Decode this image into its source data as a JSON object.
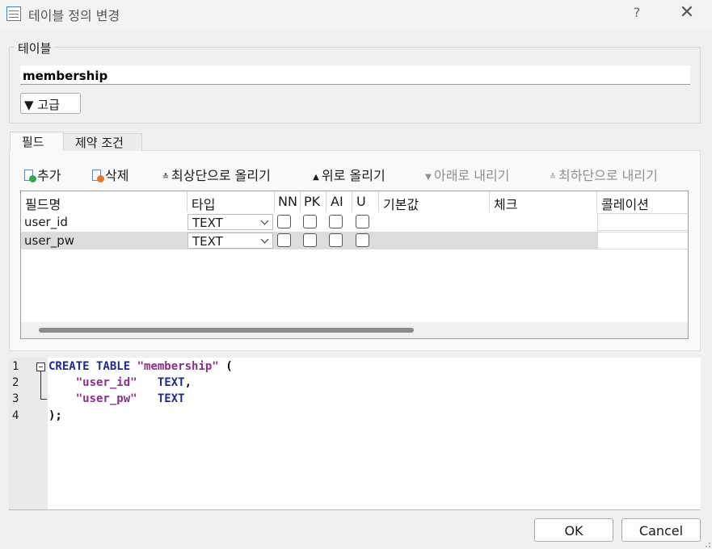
{
  "window": {
    "title": "테이블 정의 변경",
    "help": "?",
    "close": "✕"
  },
  "table_group": {
    "legend": "테이블",
    "name_value": "membership",
    "advanced_label": "▼ 고급"
  },
  "tabs": [
    {
      "label": "필드",
      "active": true
    },
    {
      "label": "제약 조건",
      "active": false
    }
  ],
  "toolbar": {
    "add": "추가",
    "delete": "삭제",
    "move_top": "최상단으로 올리기",
    "move_up": "위로 올리기",
    "move_down": "아래로 내리기",
    "move_bottom": "최하단으로 내리기"
  },
  "grid": {
    "columns": [
      "필드명",
      "타입",
      "NN",
      "PK",
      "AI",
      "U",
      "기본값",
      "체크",
      "콜레이션"
    ],
    "rows": [
      {
        "name": "user_id",
        "type": "TEXT",
        "nn": false,
        "pk": false,
        "ai": false,
        "u": false,
        "default": "",
        "check": "",
        "collation": ""
      },
      {
        "name": "user_pw",
        "type": "TEXT",
        "nn": false,
        "pk": false,
        "ai": false,
        "u": false,
        "default": "",
        "check": "",
        "collation": ""
      }
    ]
  },
  "sql": {
    "line_numbers": [
      "1",
      "2",
      "3",
      "4"
    ],
    "l1_kw": "CREATE TABLE",
    "l1_name": "\"membership\"",
    "l1_paren": "(",
    "l2_field": "\"user_id\"",
    "l2_type": "TEXT",
    "l2_sep": ",",
    "l3_field": "\"user_pw\"",
    "l3_type": "TEXT",
    "l4_end": ");"
  },
  "buttons": {
    "ok": "OK",
    "cancel": "Cancel"
  },
  "colors": {
    "keyword": "#1e2a8c",
    "string": "#8e2d8e",
    "add_badge": "#2fa84f",
    "delete_badge": "#e07a2a"
  }
}
